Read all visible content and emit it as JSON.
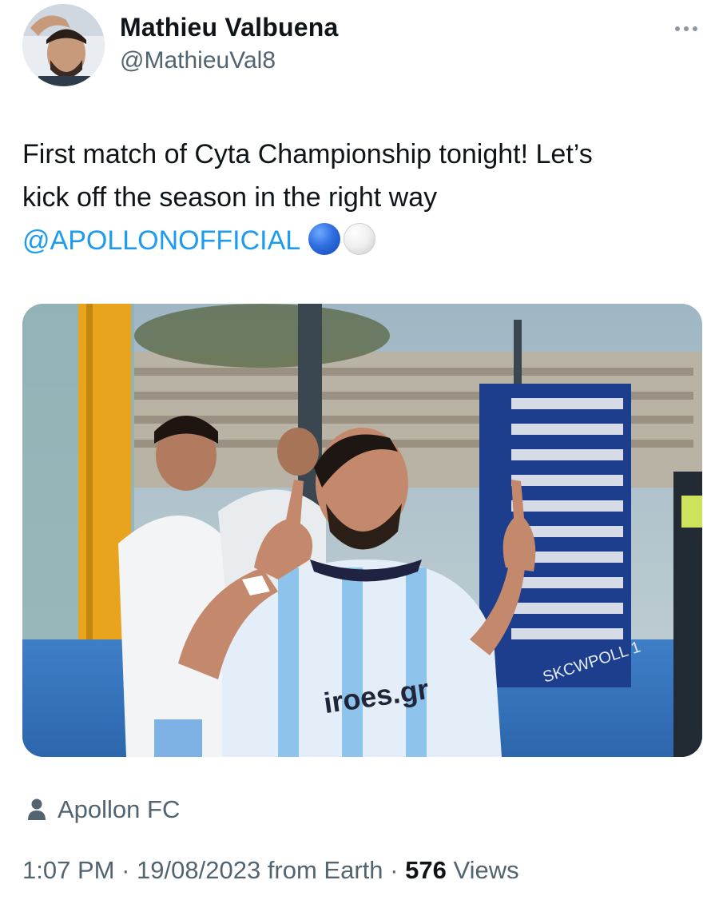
{
  "author": {
    "name": "Mathieu Valbuena",
    "handle": "@MathieuVal8"
  },
  "tweet": {
    "line1": "First match of Cyta Championship tonight! Let’s",
    "line2": "kick off the season in the right way",
    "mention": "@APOLLONOFFICIAL",
    "emojis": [
      "blue-circle",
      "white-circle"
    ]
  },
  "photo": {
    "shirt_sponsor": "iroes.gr",
    "board_text": "SKCWPOLL 1"
  },
  "tagged": {
    "label": "Apollon FC",
    "icon": "person-icon"
  },
  "meta": {
    "time": "1:07 PM",
    "separator": "·",
    "date": "19/08/2023",
    "source": "from Earth",
    "views_count": "576",
    "views_label": "Views"
  },
  "colors": {
    "link": "#1d9bf0",
    "secondary_text": "#536471",
    "primary_text": "#0f1419"
  }
}
